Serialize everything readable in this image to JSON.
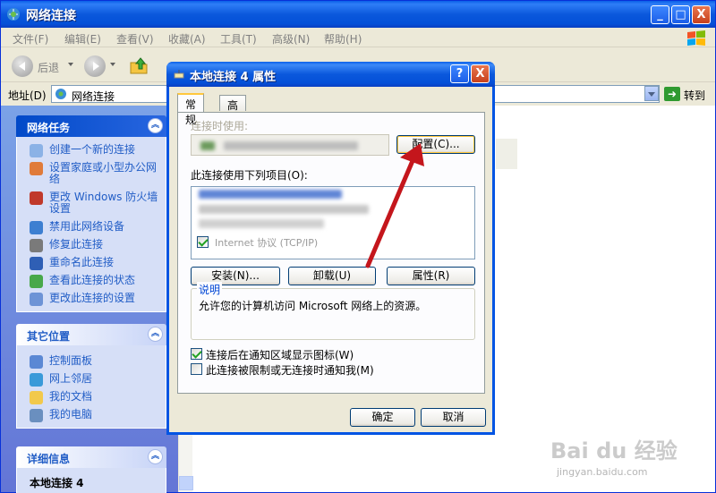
{
  "window": {
    "title": "网络连接",
    "min": "_",
    "max": "□",
    "close": "X"
  },
  "menu": [
    "文件(F)",
    "编辑(E)",
    "查看(V)",
    "收藏(A)",
    "工具(T)",
    "高级(N)",
    "帮助(H)"
  ],
  "toolbar": {
    "back": "后退",
    "forward_drop": ""
  },
  "address": {
    "label": "地址(D)",
    "value": "网络连接",
    "go": "转到"
  },
  "tasks": {
    "network_tasks": {
      "title": "网络任务",
      "items": [
        "创建一个新的连接",
        "设置家庭或小型办公网络",
        "更改 Windows 防火墙设置",
        "禁用此网络设备",
        "修复此连接",
        "重命名此连接",
        "查看此连接的状态",
        "更改此连接的设置"
      ]
    },
    "other_places": {
      "title": "其它位置",
      "items": [
        "控制面板",
        "网上邻居",
        "我的文档",
        "我的电脑"
      ]
    },
    "details": {
      "title": "详细信息",
      "subtitle": "本地连接 4"
    }
  },
  "dialog": {
    "title": "本地连接 4 属性",
    "help": "?",
    "close": "X",
    "tabs": [
      "常规",
      "高级"
    ],
    "connect_using_label": "连接时使用:",
    "configure_button": "配置(C)...",
    "items_label": "此连接使用下列项目(O):",
    "list_items": [
      "Internet 协议 (TCP/IP)"
    ],
    "install_button": "安装(N)...",
    "uninstall_button": "卸载(U)",
    "properties_button": "属性(R)",
    "description_title": "说明",
    "description_text": "允许您的计算机访问 Microsoft 网络上的资源。",
    "checkbox_show_icon": "连接后在通知区域显示图标(W)",
    "checkbox_show_icon_checked": true,
    "checkbox_notify": "此连接被限制或无连接时通知我(M)",
    "checkbox_notify_checked": false,
    "ok_button": "确定",
    "cancel_button": "取消"
  },
  "watermark": {
    "brand": "Bai du 经验",
    "url": "jingyan.baidu.com"
  },
  "colors": {
    "xp_blue": "#0054e3",
    "task_link": "#215dc6",
    "annotation_arrow": "#c4161c"
  }
}
